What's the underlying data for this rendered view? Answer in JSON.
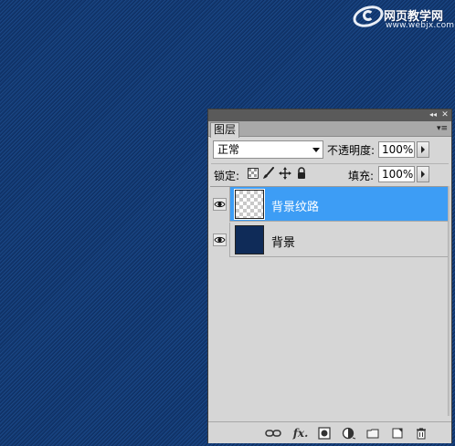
{
  "watermark": {
    "title": "网页教学网",
    "url": "www.webjx.com"
  },
  "panel": {
    "tab_label": "图层",
    "collapse_icon": "◂◂",
    "close_icon": "✕",
    "menu_icon": "▾≡",
    "blend_mode": "正常",
    "opacity_label": "不透明度:",
    "opacity_value": "100%",
    "lock_label": "锁定:",
    "fill_label": "填充:",
    "fill_value": "100%",
    "layers": [
      {
        "name": "背景纹路",
        "selected": true,
        "visible": true
      },
      {
        "name": "背景",
        "selected": false,
        "visible": true
      }
    ],
    "bottom_icons": [
      "link-icon",
      "fx-icon",
      "mask-icon",
      "adjustment-icon",
      "group-icon",
      "new-layer-icon",
      "trash-icon"
    ],
    "fx_label": "fx."
  },
  "colors": {
    "canvas_blue": "#11346a",
    "selected_row": "#3d9df5",
    "panel_bg": "#d6d6d6"
  }
}
